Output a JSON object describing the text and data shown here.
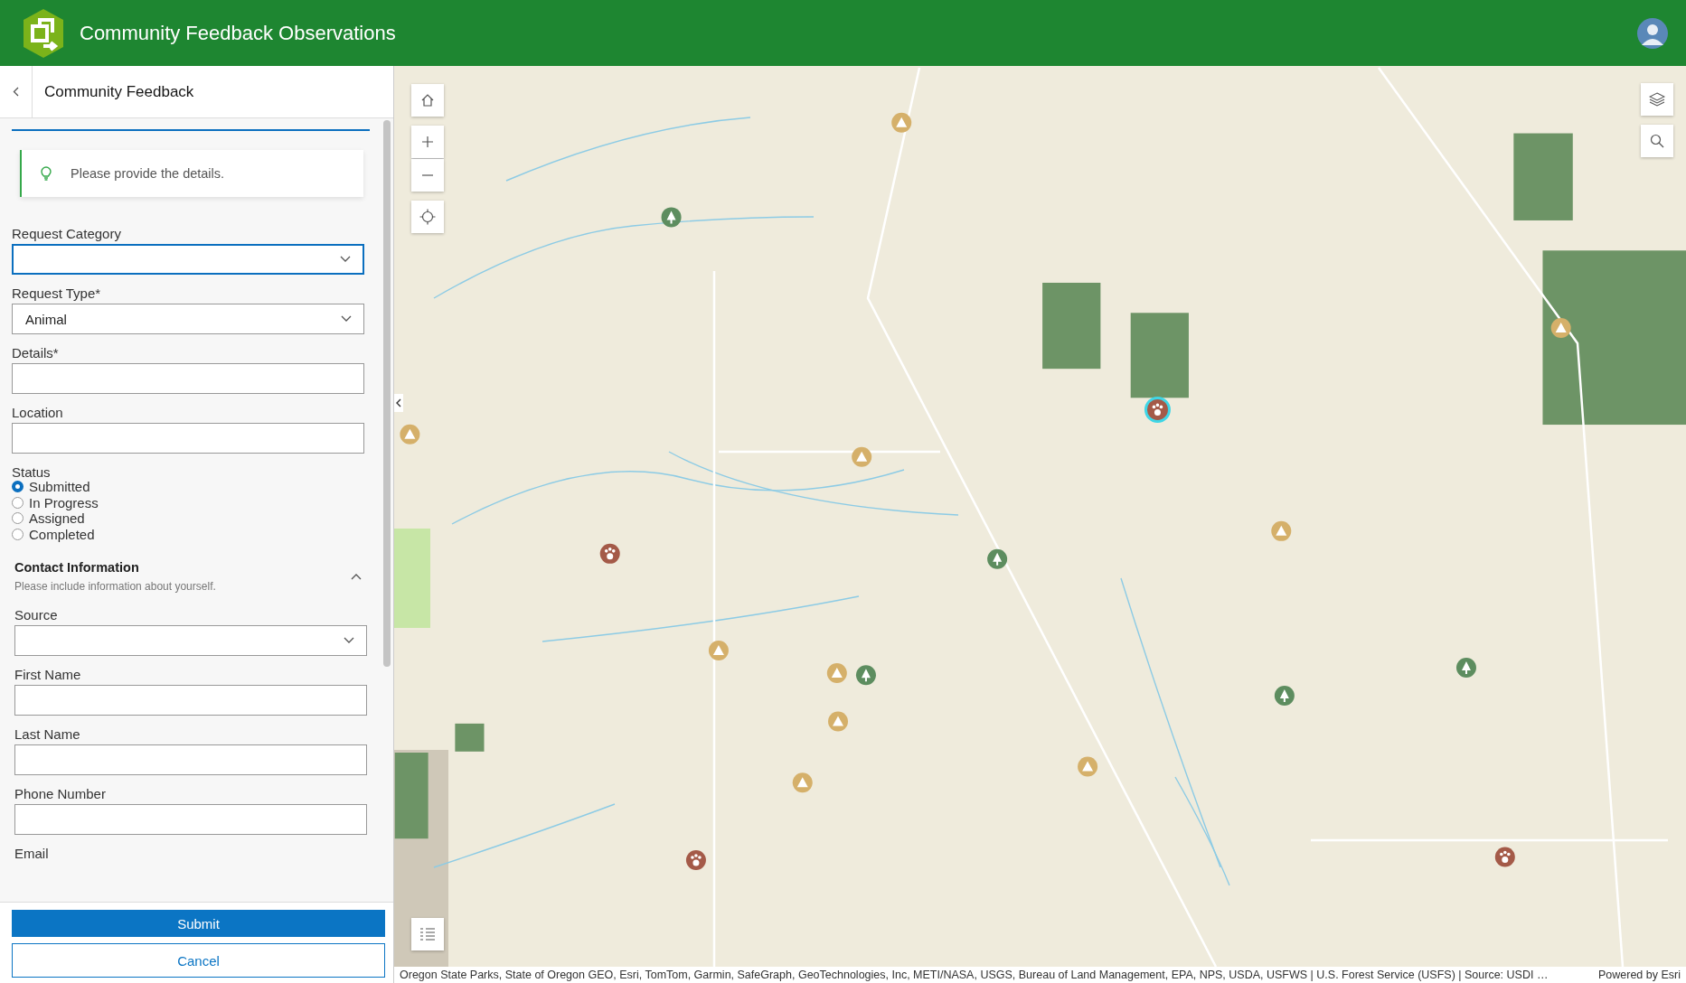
{
  "header": {
    "title": "Community Feedback Observations"
  },
  "panel": {
    "title": "Community Feedback",
    "notice": "Please provide the details.",
    "fields": [
      {
        "kind": "select",
        "label": "Request Category",
        "focused": true
      },
      {
        "kind": "select",
        "label": "Request Type*",
        "value": "Animal",
        "focused": false
      },
      {
        "kind": "text",
        "label": "Details*",
        "focused": false
      },
      {
        "kind": "text",
        "label": "Location",
        "focused": false
      },
      {
        "kind": "radio",
        "label": "Status",
        "options": [
          {
            "label": "Submitted",
            "selected": true
          },
          {
            "label": "In Progress",
            "selected": false
          },
          {
            "label": "Assigned",
            "selected": false
          },
          {
            "label": "Completed",
            "selected": false
          }
        ]
      }
    ],
    "section": {
      "title": "Contact Information",
      "description": "Please include information about yourself.",
      "expanded": true,
      "fields": [
        {
          "kind": "select",
          "label": "Source",
          "focused": false
        },
        {
          "kind": "text",
          "label": "First Name",
          "focused": false
        },
        {
          "kind": "text",
          "label": "Last Name",
          "focused": false
        },
        {
          "kind": "text",
          "label": "Phone Number",
          "focused": false
        },
        {
          "kind": "label",
          "label": "Email"
        }
      ]
    },
    "buttons": [
      {
        "label": "Submit",
        "kind": "primary"
      },
      {
        "label": "Cancel",
        "kind": "secondary"
      }
    ]
  },
  "map": {
    "attribution": "Oregon State Parks, State of Oregon GEO, Esri, TomTom, Garmin, SafeGraph, GeoTechnologies, Inc, METI/NASA, USGS, Bureau of Land Management, EPA, NPS, USDA, USFWS | U.S. Forest Service (USFS) | Source: USDI …",
    "powered_by": "Powered by Esri"
  }
}
